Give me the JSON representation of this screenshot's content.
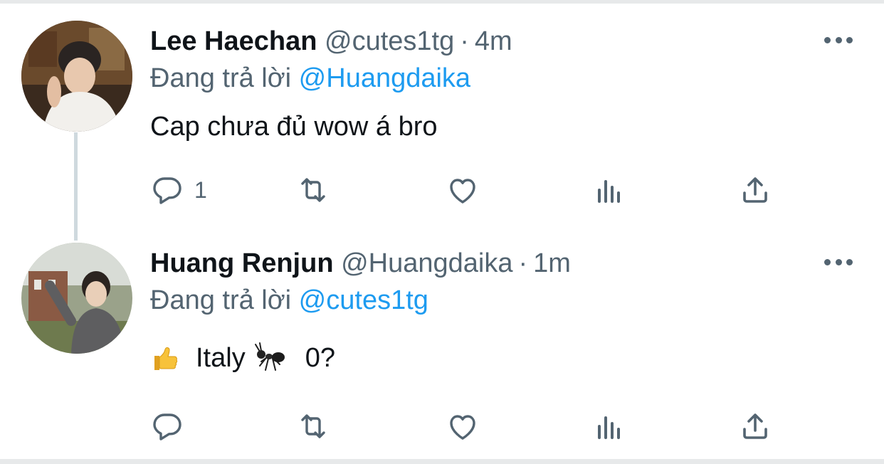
{
  "tweets": [
    {
      "display_name": "Lee Haechan",
      "handle": "@cutes1tg",
      "separator": "·",
      "time": "4m",
      "reply_prefix": "Đang trả lời",
      "reply_to": "@Huangdaika",
      "text": "Cap chưa đủ wow á bro",
      "reply_count": "1",
      "avatar_icon": "user-photo-avatar"
    },
    {
      "display_name": "Huang Renjun",
      "handle": "@Huangdaika",
      "separator": "·",
      "time": "1m",
      "reply_prefix": "Đang trả lời",
      "reply_to": "@cutes1tg",
      "text_parts": [
        "Italy",
        "0?"
      ],
      "emojis": [
        "thumbs-up-emoji",
        "ant-emoji"
      ],
      "reply_count": "",
      "avatar_icon": "user-photo-avatar"
    }
  ],
  "icons": [
    "reply-icon",
    "retweet-icon",
    "like-icon",
    "views-icon",
    "share-icon",
    "more-icon"
  ],
  "colors": {
    "text_primary": "#0f1419",
    "text_secondary": "#536471",
    "mention": "#1d9bf0",
    "thread_line": "#cfd9de",
    "divider": "#e7e9ea"
  }
}
